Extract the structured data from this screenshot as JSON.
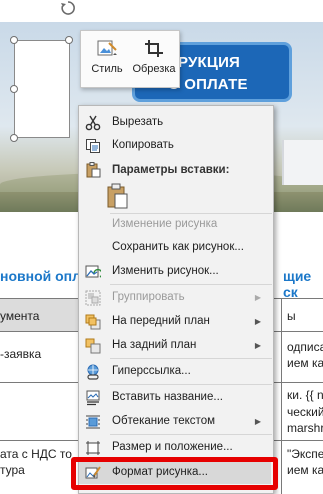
{
  "banner": {
    "line1": "СТРУКЦИЯ",
    "line2": "О ОПЛАТЕ"
  },
  "document": {
    "heading_left": "новной опл",
    "heading_right": "щие ск",
    "rows": [
      {
        "left": "умента",
        "right": "ы"
      },
      {
        "left": "-заявка",
        "right": "одписан"
      },
      {
        "left": "",
        "right": "ием каче"
      },
      {
        "left": "",
        "right": "ки. {{ nu"
      },
      {
        "left": "",
        "right": "ческий а"
      },
      {
        "left": "",
        "right": "marshru"
      },
      {
        "left": "ата с НДС то",
        "right": "\"Экспед"
      },
      {
        "left": "тура",
        "right": "ием кач"
      }
    ]
  },
  "mini_toolbar": {
    "style_label": "Стиль",
    "crop_label": "Обрезка"
  },
  "context_menu": {
    "items": [
      {
        "label": "Вырезать",
        "icon": "scissors-icon",
        "enabled": true
      },
      {
        "label": "Копировать",
        "icon": "copy-icon",
        "enabled": true
      },
      {
        "label": "Параметры вставки:",
        "icon": "paste-icon",
        "section": true
      },
      {
        "label": "Изменение рисунка",
        "enabled": false
      },
      {
        "label": "Сохранить как рисунок...",
        "enabled": true
      },
      {
        "label": "Изменить рисунок...",
        "icon": "change-picture-icon",
        "enabled": true
      },
      {
        "label": "Группировать",
        "icon": "group-icon",
        "enabled": false,
        "submenu": true
      },
      {
        "label": "На передний план",
        "icon": "bring-forward-icon",
        "enabled": true,
        "submenu": true
      },
      {
        "label": "На задний план",
        "icon": "send-backward-icon",
        "enabled": true,
        "submenu": true
      },
      {
        "label": "Гиперссылка...",
        "icon": "hyperlink-icon",
        "enabled": true
      },
      {
        "label": "Вставить название...",
        "icon": "insert-caption-icon",
        "enabled": true
      },
      {
        "label": "Обтекание текстом",
        "icon": "wrap-text-icon",
        "enabled": true,
        "submenu": true
      },
      {
        "label": "Размер и положение...",
        "icon": "size-position-icon",
        "enabled": true
      },
      {
        "label": "Формат рисунка...",
        "icon": "format-picture-icon",
        "enabled": true
      }
    ]
  },
  "colors": {
    "highlight": "#e60000",
    "heading": "#1c78c9",
    "banner_sign": "#1c67b7"
  }
}
